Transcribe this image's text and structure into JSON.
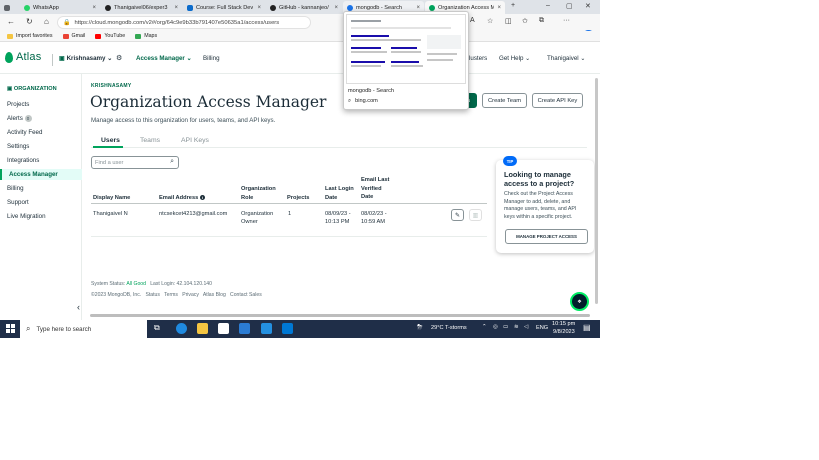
{
  "browser": {
    "tabs": [
      {
        "label": "WhatsApp",
        "icon": "whatsapp-icon",
        "color": "#25d366"
      },
      {
        "label": "Thanigaivel06/exper3",
        "icon": "github-icon",
        "color": "#222222"
      },
      {
        "label": "Course: Full Stack Dev",
        "icon": "course-icon",
        "color": "#0b6bcb"
      },
      {
        "label": "GitHub - kannanjeo/",
        "icon": "github-icon",
        "color": "#222222"
      },
      {
        "label": "mongodb - Search",
        "icon": "search-icon",
        "color": "#1a73e8"
      },
      {
        "label": "Organization Access M",
        "icon": "mongodb-leaf-icon",
        "color": "#00a35c"
      }
    ],
    "url": "https://cloud.mongodb.com/v2#/org/64c9e9b33b791407e50635a1/access/users",
    "bookmarks": [
      {
        "label": "Import favorites",
        "icon": "folder-icon",
        "color": "#f4c542"
      },
      {
        "label": "Gmail",
        "icon": "gmail-icon",
        "color": "#ea4335"
      },
      {
        "label": "YouTube",
        "icon": "youtube-icon",
        "color": "#ff0000"
      },
      {
        "label": "Maps",
        "icon": "maps-icon",
        "color": "#34a853"
      }
    ]
  },
  "popup": {
    "title": "mongodb - Search",
    "url": "bing.com"
  },
  "header": {
    "logo": "Atlas",
    "org_name": "Krishnasamy",
    "access_manager": "Access Manager",
    "billing": "Billing",
    "clusters": "lusters",
    "get_help": "Get Help",
    "user": "Thanigaivel"
  },
  "sidebar": {
    "section": "ORGANIZATION",
    "items": [
      "Projects",
      "Alerts",
      "Activity Feed",
      "Settings",
      "Integrations",
      "Access Manager",
      "Billing",
      "Support",
      "Live Migration"
    ],
    "alerts_badge": "0"
  },
  "main": {
    "org_tag": "KRISHNASAMY",
    "title": "Organization Access Manager",
    "subtitle": "Manage access to this organization for users, teams, and API keys.",
    "buttons": {
      "invite": "s",
      "create_team": "Create Team",
      "create_api_key": "Create API Key"
    },
    "tabs": [
      "Users",
      "Teams",
      "API Keys"
    ],
    "filter_placeholder": "Find a user",
    "table": {
      "headers": [
        "Display Name",
        "Email Address",
        "Organization Role",
        "Projects",
        "Last Login Date",
        "Email Last Verified Date"
      ],
      "rows": [
        {
          "name": "Thanigaivel N",
          "email": "ntcsekcet4213@gmail.com",
          "role": "Organization Owner",
          "projects": "1",
          "last_login": "08/09/23 - 10:13 PM",
          "verified": "08/02/23 - 10:59 AM"
        }
      ]
    }
  },
  "tip": {
    "badge": "TIP",
    "title": "Looking to manage access to a project?",
    "body": "Check out the Project Access Manager to add, delete, and manage users, teams, and API keys within a specific project.",
    "button": "MANAGE PROJECT ACCESS"
  },
  "footer": {
    "system_status_label": "System Status:",
    "system_status_value": "All Good",
    "last_login": "Last Login: 42.104.120.140",
    "copyright": "©2023 MongoDB, Inc.",
    "links": [
      "Status",
      "Terms",
      "Privacy",
      "Atlas Blog",
      "Contact Sales"
    ]
  },
  "taskbar": {
    "search_placeholder": "Type here to search",
    "weather": "29°C  T-storms",
    "language": "ENG",
    "time": "10:15 pm",
    "date": "9/8/2023"
  },
  "colors": {
    "accent_green": "#00a35c",
    "dark_green": "#00684a",
    "tip_blue": "#016bf8",
    "taskbar": "#1f2e48"
  }
}
